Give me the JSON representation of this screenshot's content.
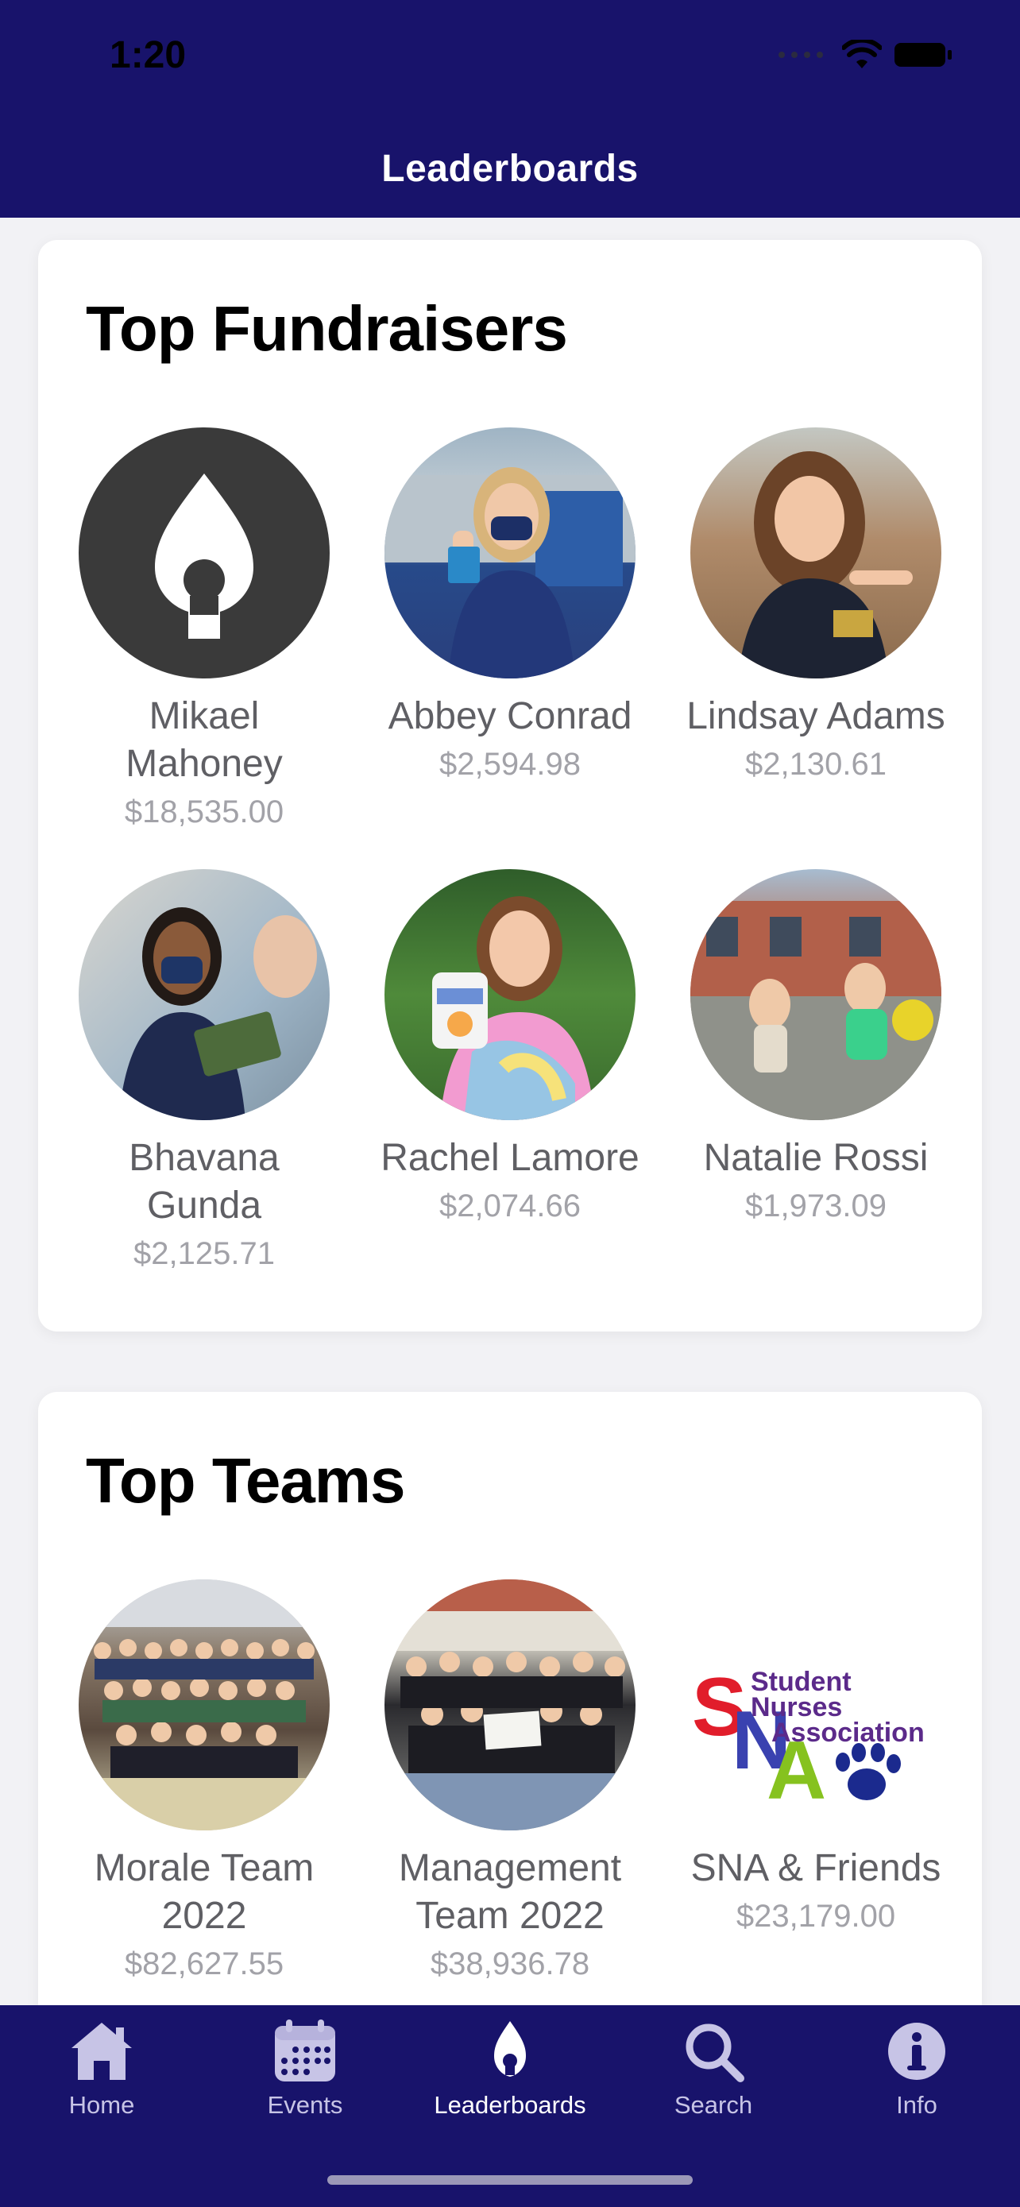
{
  "status": {
    "time": "1:20"
  },
  "header": {
    "title": "Leaderboards"
  },
  "fundraisers": {
    "title": "Top Fundraisers",
    "people": [
      {
        "name": "Mikael Mahoney",
        "amount": "$18,535.00",
        "avatar": "flame-logo"
      },
      {
        "name": "Abbey Conrad",
        "amount": "$2,594.98",
        "avatar": "photo"
      },
      {
        "name": "Lindsay Adams",
        "amount": "$2,130.61",
        "avatar": "photo"
      },
      {
        "name": "Bhavana Gunda",
        "amount": "$2,125.71",
        "avatar": "photo"
      },
      {
        "name": "Rachel Lamore",
        "amount": "$2,074.66",
        "avatar": "photo"
      },
      {
        "name": "Natalie Rossi",
        "amount": "$1,973.09",
        "avatar": "photo"
      }
    ]
  },
  "teams": {
    "title": "Top Teams",
    "items": [
      {
        "name": "Morale Team 2022",
        "amount": "$82,627.55",
        "avatar": "group-photo"
      },
      {
        "name": "Management Team 2022",
        "amount": "$38,936.78",
        "avatar": "group-photo"
      },
      {
        "name": "SNA & Friends",
        "amount": "$23,179.00",
        "avatar": "sna-logo"
      }
    ],
    "sna_logo": {
      "line1": "Student",
      "line2": "Nurses",
      "line3": "Association",
      "letters": "SNA"
    }
  },
  "tabbar": {
    "tabs": [
      {
        "label": "Home",
        "icon": "house-icon"
      },
      {
        "label": "Events",
        "icon": "calendar-icon"
      },
      {
        "label": "Leaderboards",
        "icon": "flame-icon",
        "active": true
      },
      {
        "label": "Search",
        "icon": "magnifier-icon"
      },
      {
        "label": "Info",
        "icon": "info-icon"
      }
    ]
  },
  "colors": {
    "brand": "#18136b",
    "active_tab": "#ffffff",
    "inactive_tab": "#c7c4e6"
  }
}
